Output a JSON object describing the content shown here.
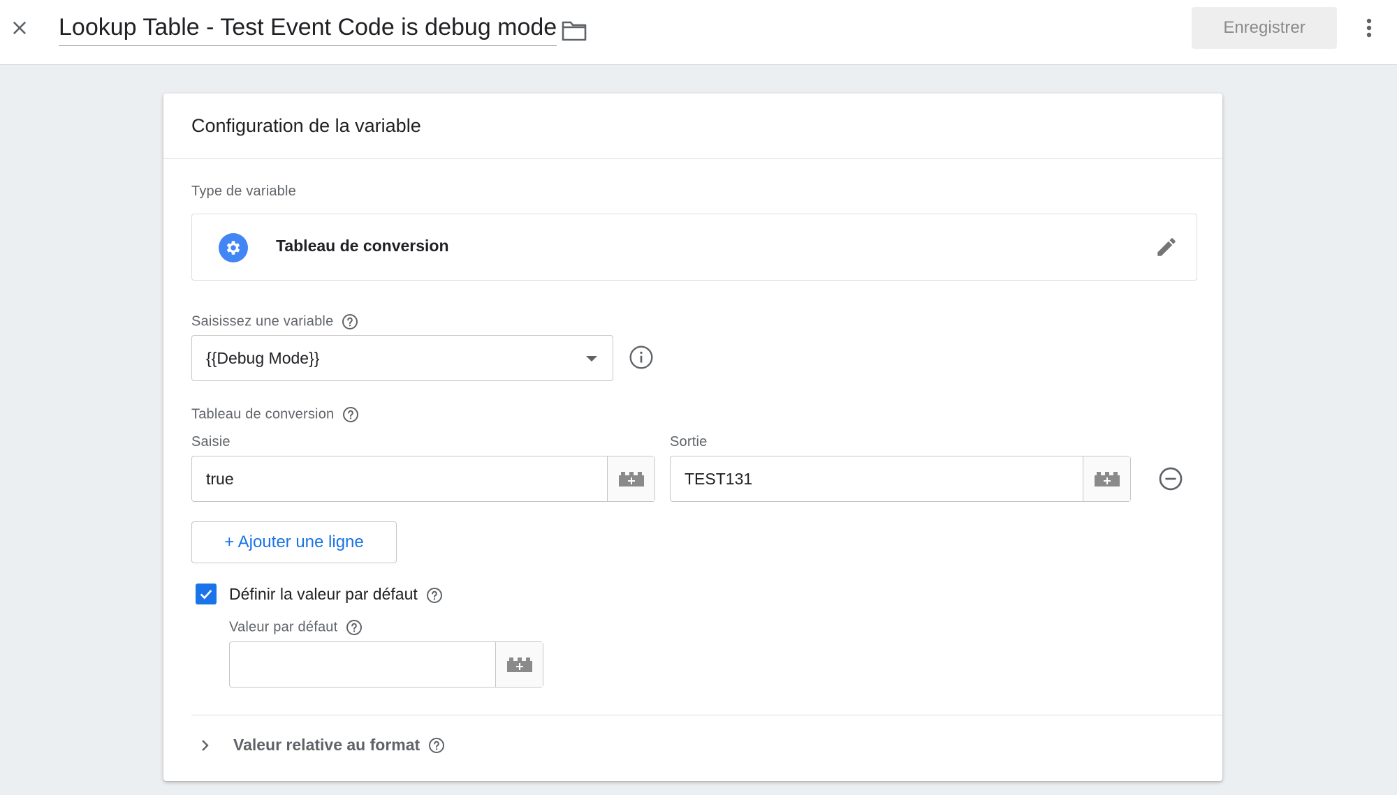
{
  "header": {
    "title": "Lookup Table - Test Event Code is debug mode",
    "save_label": "Enregistrer"
  },
  "card": {
    "title": "Configuration de la variable",
    "variable_type": {
      "label": "Type de variable",
      "name": "Tableau de conversion"
    },
    "input_variable": {
      "label": "Saisissez une variable",
      "value": "{{Debug Mode}}"
    },
    "lookup_table": {
      "label": "Tableau de conversion",
      "input_header": "Saisie",
      "output_header": "Sortie",
      "rows": [
        {
          "input": "true",
          "output": "TEST131"
        }
      ],
      "add_row_label": "+ Ajouter une ligne"
    },
    "default_value": {
      "checkbox_label": "Définir la valeur par défaut",
      "checked": true,
      "field_label": "Valeur par défaut",
      "value": ""
    },
    "format_section": {
      "label": "Valeur relative au format"
    }
  },
  "colors": {
    "accent": "#1a73e8",
    "icon_blue": "#4285f4",
    "background": "#eceff1"
  },
  "icons": [
    "close-icon",
    "folder-icon",
    "more-vert-icon",
    "gear-icon",
    "pencil-icon",
    "help-icon",
    "info-icon",
    "dropdown-arrow-icon",
    "variable-block-icon",
    "remove-circle-icon",
    "checkmark-icon",
    "chevron-right-icon"
  ]
}
